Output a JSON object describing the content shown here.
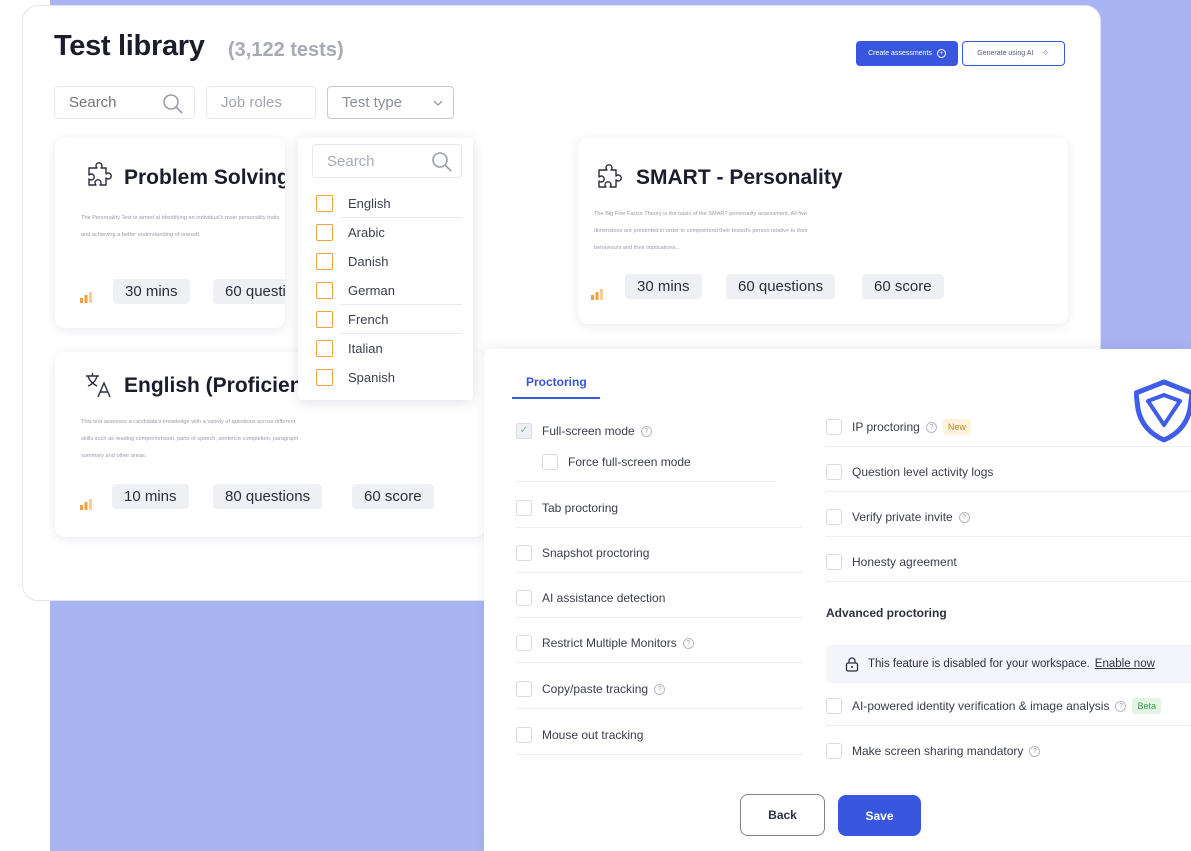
{
  "library": {
    "title": "Test library",
    "count": "(3,122 tests)",
    "create_button": "Create assessments",
    "generate_button": "Generate using AI",
    "search_placeholder": "Search",
    "job_roles": "Job roles",
    "test_type": "Test type"
  },
  "cards": [
    {
      "title": "Problem Solving",
      "description": "The Personality Test is aimed at identifying an individual's main personality traits and achieving a better understanding of oneself.",
      "duration": "30 mins",
      "questions": "60 questions",
      "icon": "puzzle-icon"
    },
    {
      "title": "SMART - Personality",
      "description": "The Big Five Factor Theory is the basis of the SMART personality assessment. All five dimensions are presented in order to comprehend their tested's person relative to their behaviours and their implications...",
      "duration": "30 mins",
      "questions": "60 questions",
      "score": "60 score",
      "icon": "puzzle-icon"
    },
    {
      "title": "English (Proficiency)",
      "description": "This test assesses a candidate's knowledge with a variety of questions across different skills such as reading comprehension, parts of speech, sentence completion, paragraph summary and other areas.",
      "duration": "10 mins",
      "questions": "80 questions",
      "score": "60 score",
      "icon": "translate-icon"
    }
  ],
  "dropdown": {
    "search_placeholder": "Search",
    "options": [
      "English",
      "Arabic",
      "Danish",
      "German",
      "French",
      "Italian",
      "Spanish"
    ]
  },
  "proctoring": {
    "tab": "Proctoring",
    "left_options": [
      {
        "label": "Full-screen mode",
        "checked": true,
        "help": true
      },
      {
        "label": "Force full-screen mode",
        "checked": false,
        "help": false
      },
      {
        "label": "Tab proctoring",
        "checked": false,
        "help": false
      },
      {
        "label": "Snapshot proctoring",
        "checked": false,
        "help": false
      },
      {
        "label": "AI assistance detection",
        "checked": false,
        "help": false
      },
      {
        "label": "Restrict Multiple Monitors",
        "checked": false,
        "help": true
      },
      {
        "label": "Copy/paste tracking",
        "checked": false,
        "help": true
      },
      {
        "label": "Mouse out tracking",
        "checked": false,
        "help": false
      }
    ],
    "right_options": [
      {
        "label": "IP proctoring",
        "badge": "New",
        "help": true
      },
      {
        "label": "Question level activity logs",
        "help": false
      },
      {
        "label": "Verify private invite",
        "help": true
      },
      {
        "label": "Honesty agreement",
        "help": false
      }
    ],
    "advanced_title": "Advanced proctoring",
    "disabled_text": "This feature is disabled for your workspace.",
    "enable_link": "Enable now",
    "advanced_options": [
      {
        "label": "AI-powered identity verification & image analysis",
        "badge": "Beta",
        "help": true
      },
      {
        "label": "Make screen sharing mandatory",
        "help": true
      }
    ],
    "back": "Back",
    "save": "Save"
  },
  "colors": {
    "accent": "#3956df",
    "checkbox_orange": "#f0a241",
    "background_blue": "#a8b4f3"
  }
}
